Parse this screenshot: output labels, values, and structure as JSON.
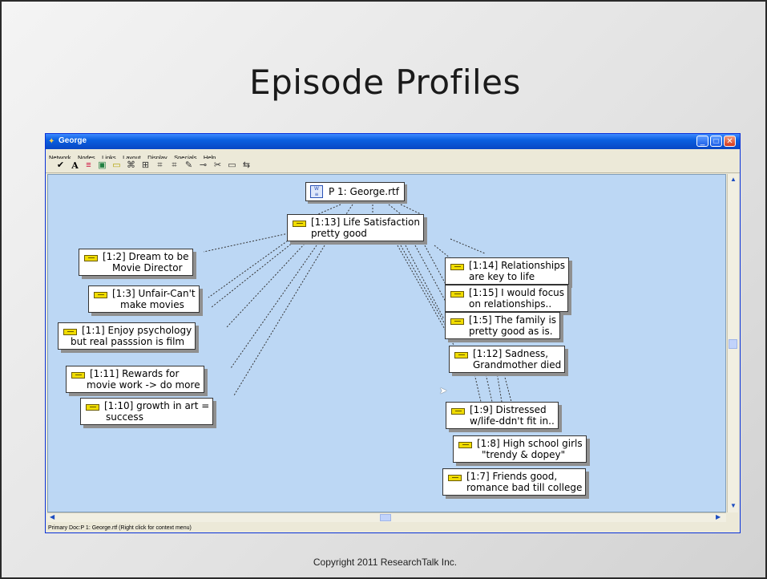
{
  "slide": {
    "title": "Episode Profiles",
    "copyright": "Copyright 2011  ResearchTalk Inc."
  },
  "window": {
    "title": "George",
    "menu": [
      "Network",
      "Nodes",
      "Links",
      "Layout",
      "Display",
      "Specials",
      "Help"
    ],
    "toolbar_icons": [
      "check-icon",
      "font-icon",
      "line-style-icon",
      "fill-color-icon",
      "node-color-icon",
      "layout-icon",
      "layout-icon-2",
      "layout-icon-3",
      "layout-icon-4",
      "pencil-icon",
      "link-icon",
      "cut-icon",
      "comment-icon",
      "export-icon"
    ],
    "status": "Primary Doc:P 1: George.rtf (Right click for context menu)",
    "accent": "#0a5fe0",
    "canvas_color": "#bcd7f4"
  },
  "network": {
    "document": "P 1: George.rtf",
    "root": {
      "line1": "[1:13] Life Satisfaction",
      "line2": "pretty good"
    },
    "left_nodes": [
      {
        "line1": "[1:2] Dream to be",
        "line2": "Movie Director"
      },
      {
        "line1": "[1:3] Unfair-Can't",
        "line2": "make movies"
      },
      {
        "line1": "[1:1] Enjoy psychology",
        "line2": "but real passsion is film"
      },
      {
        "line1": "[1:11] Rewards for",
        "line2": "movie work -> do more"
      },
      {
        "line1": "[1:10] growth in art =",
        "line2": "success"
      }
    ],
    "right_nodes": [
      {
        "line1": "[1:14] Relationships",
        "line2": "are key to life"
      },
      {
        "line1": "[1:15] I would focus",
        "line2": "on relationships.."
      },
      {
        "line1": "[1:5] The family is",
        "line2": "pretty good as is."
      },
      {
        "line1": "[1:12] Sadness,",
        "line2": "Grandmother died"
      },
      {
        "line1": "[1:9] Distressed",
        "line2": "w/life-ddn't fit in.."
      },
      {
        "line1": "[1:8] High school girls",
        "line2": "\"trendy & dopey\""
      },
      {
        "line1": "[1:7] Friends good,",
        "line2": "romance bad till college"
      }
    ]
  }
}
